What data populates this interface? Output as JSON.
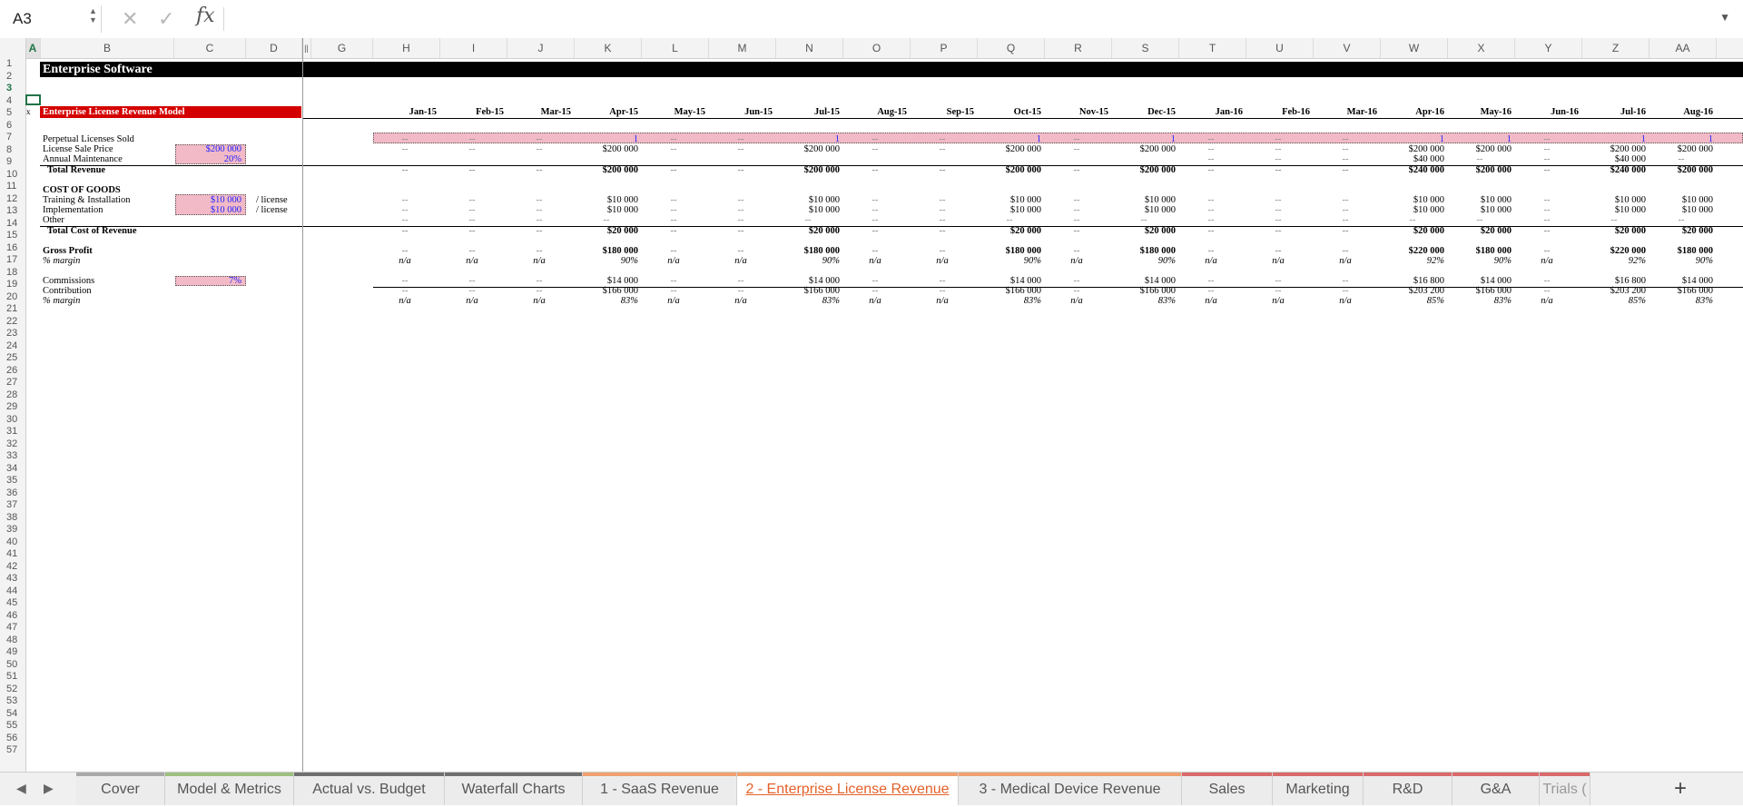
{
  "formula_bar": {
    "name_box": "A3",
    "formula": "",
    "cancel_icon": "✕",
    "confirm_icon": "✓",
    "fx_label": "fx"
  },
  "columns": [
    "A",
    "B",
    "C",
    "D",
    "G",
    "H",
    "I",
    "J",
    "K",
    "L",
    "M",
    "N",
    "O",
    "P",
    "Q",
    "R",
    "S",
    "T",
    "U",
    "V",
    "W",
    "X",
    "Y",
    "Z",
    "AA"
  ],
  "row_numbers": [
    "1",
    "2",
    "3",
    "4",
    "5",
    "6",
    "7",
    "8",
    "9",
    "10",
    "11",
    "12",
    "13",
    "14",
    "15",
    "16",
    "17",
    "18",
    "19",
    "20",
    "21",
    "22",
    "23",
    "24",
    "25",
    "26",
    "27",
    "28",
    "29",
    "30",
    "31",
    "32",
    "33",
    "34",
    "35",
    "36",
    "37",
    "38",
    "39",
    "40",
    "41",
    "42",
    "43",
    "44",
    "45",
    "46",
    "47",
    "48",
    "49",
    "50",
    "51",
    "52",
    "53",
    "54",
    "55",
    "56",
    "57"
  ],
  "sheet": {
    "title": "Enterprise Software",
    "model_header": "Enterprise License Revenue Model",
    "row4_marker": "x",
    "months": [
      "Jan-15",
      "Feb-15",
      "Mar-15",
      "Apr-15",
      "May-15",
      "Jun-15",
      "Jul-15",
      "Aug-15",
      "Sep-15",
      "Oct-15",
      "Nov-15",
      "Dec-15",
      "Jan-16",
      "Feb-16",
      "Mar-16",
      "Apr-16",
      "May-16",
      "Jun-16",
      "Jul-16",
      "Aug-16"
    ],
    "labels": {
      "perpetual": "Perpetual Licenses Sold",
      "price": "License Sale Price",
      "maintenance": "Annual Maintenance",
      "total_revenue": "Total Revenue",
      "cogs": "COST OF GOODS",
      "training": "Training & Installation",
      "implementation": "Implementation",
      "other": "Other",
      "total_cost": "Total Cost of Revenue",
      "gross_profit": "Gross Profit",
      "gp_margin": "% margin",
      "commissions": "Commissions",
      "contribution": "Contribution",
      "contrib_margin": "% margin"
    },
    "inputs": {
      "price": "$200 000",
      "maintenance": "20%",
      "training": "$10 000",
      "implementation": "$10 000",
      "commissions": "7%",
      "per_license": "/ license"
    },
    "rows": {
      "r6": [
        "--",
        "--",
        "--",
        "1",
        "--",
        "--",
        "1",
        "--",
        "--",
        "1",
        "--",
        "1",
        "--",
        "--",
        "--",
        "1",
        "1",
        "--",
        "1",
        "1"
      ],
      "r7": [
        "--",
        "--",
        "--",
        "$200 000",
        "--",
        "--",
        "$200 000",
        "--",
        "--",
        "$200 000",
        "--",
        "$200 000",
        "--",
        "--",
        "--",
        "$200 000",
        "$200 000",
        "--",
        "$200 000",
        "$200 000"
      ],
      "r8": [
        "",
        "",
        "",
        "",
        "",
        "",
        "",
        "",
        "",
        "",
        "",
        "",
        "--",
        "--",
        "--",
        "$40 000",
        "--",
        "--",
        "$40 000",
        "--"
      ],
      "r9": [
        "--",
        "--",
        "--",
        "$200 000",
        "--",
        "--",
        "$200 000",
        "--",
        "--",
        "$200 000",
        "--",
        "$200 000",
        "--",
        "--",
        "--",
        "$240 000",
        "$200 000",
        "--",
        "$240 000",
        "$200 000"
      ],
      "r12": [
        "--",
        "--",
        "--",
        "$10 000",
        "--",
        "--",
        "$10 000",
        "--",
        "--",
        "$10 000",
        "--",
        "$10 000",
        "--",
        "--",
        "--",
        "$10 000",
        "$10 000",
        "--",
        "$10 000",
        "$10 000"
      ],
      "r13": [
        "--",
        "--",
        "--",
        "$10 000",
        "--",
        "--",
        "$10 000",
        "--",
        "--",
        "$10 000",
        "--",
        "$10 000",
        "--",
        "--",
        "--",
        "$10 000",
        "$10 000",
        "--",
        "$10 000",
        "$10 000"
      ],
      "r14": [
        "--",
        "--",
        "--",
        "--",
        "--",
        "--",
        "--",
        "--",
        "--",
        "--",
        "--",
        "--",
        "--",
        "--",
        "--",
        "--",
        "--",
        "--",
        "--",
        "--"
      ],
      "r15": [
        "--",
        "--",
        "--",
        "$20 000",
        "--",
        "--",
        "$20 000",
        "--",
        "--",
        "$20 000",
        "--",
        "$20 000",
        "--",
        "--",
        "--",
        "$20 000",
        "$20 000",
        "--",
        "$20 000",
        "$20 000"
      ],
      "r17": [
        "--",
        "--",
        "--",
        "$180 000",
        "--",
        "--",
        "$180 000",
        "--",
        "--",
        "$180 000",
        "--",
        "$180 000",
        "--",
        "--",
        "--",
        "$220 000",
        "$180 000",
        "--",
        "$220 000",
        "$180 000"
      ],
      "r18": [
        "n/a",
        "n/a",
        "n/a",
        "90%",
        "n/a",
        "n/a",
        "90%",
        "n/a",
        "n/a",
        "90%",
        "n/a",
        "90%",
        "n/a",
        "n/a",
        "n/a",
        "92%",
        "90%",
        "n/a",
        "92%",
        "90%"
      ],
      "r20": [
        "--",
        "--",
        "--",
        "$14 000",
        "--",
        "--",
        "$14 000",
        "--",
        "--",
        "$14 000",
        "--",
        "$14 000",
        "--",
        "--",
        "--",
        "$16 800",
        "$14 000",
        "--",
        "$16 800",
        "$14 000"
      ],
      "r21": [
        "--",
        "--",
        "--",
        "$166 000",
        "--",
        "--",
        "$166 000",
        "--",
        "--",
        "$166 000",
        "--",
        "$166 000",
        "--",
        "--",
        "--",
        "$203 200",
        "$166 000",
        "--",
        "$203 200",
        "$166 000"
      ],
      "r22": [
        "n/a",
        "n/a",
        "n/a",
        "83%",
        "n/a",
        "n/a",
        "83%",
        "n/a",
        "n/a",
        "83%",
        "n/a",
        "83%",
        "n/a",
        "n/a",
        "n/a",
        "85%",
        "83%",
        "n/a",
        "85%",
        "83%"
      ]
    }
  },
  "tabs": [
    {
      "label": "Cover",
      "color": "#a9a9a9",
      "active": false
    },
    {
      "label": "Model & Metrics",
      "color": "#9dbf80",
      "active": false
    },
    {
      "label": "Actual vs. Budget",
      "color": "#6f6f6f",
      "active": false
    },
    {
      "label": "Waterfall Charts",
      "color": "#6f6f6f",
      "active": false
    },
    {
      "label": "1 - SaaS Revenue",
      "color": "#f0a070",
      "active": false
    },
    {
      "label": "2 - Enterprise License Revenue",
      "color": "#f0a070",
      "active": true
    },
    {
      "label": "3 - Medical Device Revenue",
      "color": "#f0a070",
      "active": false
    },
    {
      "label": "Sales",
      "color": "#d96a6a",
      "active": false
    },
    {
      "label": "Marketing",
      "color": "#d96a6a",
      "active": false
    },
    {
      "label": "R&D",
      "color": "#d96a6a",
      "active": false
    },
    {
      "label": "G&A",
      "color": "#d96a6a",
      "active": false
    },
    {
      "label": "Trials (",
      "color": "#d96a6a",
      "active": false
    }
  ],
  "tab_nav": {
    "prev": "◀",
    "next": "▶",
    "add": "+"
  }
}
